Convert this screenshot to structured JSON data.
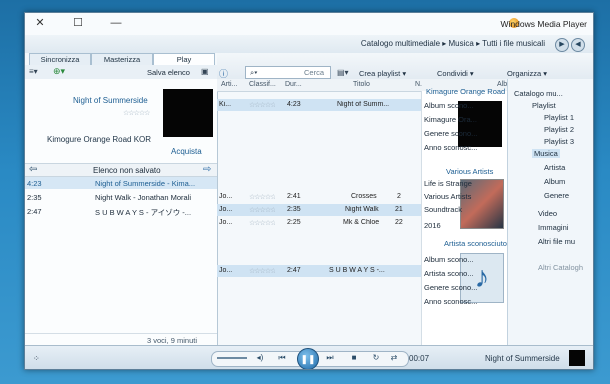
{
  "window": {
    "title": "Windows Media Player"
  },
  "nav": {
    "breadcrumb": "Catalogo multimediale ▸ Musica ▸ Tutti i file musicali",
    "back": "◀",
    "forward": "▶"
  },
  "tabs": [
    "Play",
    "Masterizza",
    "Sincronizza"
  ],
  "left_toolbar": {
    "save_label": "Salva elenco"
  },
  "toolbar": {
    "organize": "Organizza ▾",
    "share": "Condividi ▾",
    "create_playlist": "Crea playlist ▾",
    "search_placeholder": "Cerca"
  },
  "now_playing": {
    "title": "Night of Summerside",
    "artist": "Kimogure Orange Road KOR",
    "buy": "Acquista"
  },
  "playlist": {
    "header": "Elenco non salvato",
    "items": [
      {
        "title": "Night of Summerside - Kima...",
        "time": "4:23"
      },
      {
        "title": "Night Walk - Jonathan Morali",
        "time": "2:35"
      },
      {
        "title": "S U B W A Y S - アイゾウ -...",
        "time": "2:47"
      }
    ],
    "summary": "3 voci, 9 minuti"
  },
  "columns": [
    "N.",
    "Titolo",
    "Dur...",
    "Classif...",
    "Arti..."
  ],
  "album_col": "Album",
  "tracks": [
    {
      "n": "",
      "title": "Night of Summ...",
      "dur": "4:23",
      "artist": "Ki..."
    },
    {
      "n": "2",
      "title": "Crosses",
      "dur": "2:41",
      "artist": "Jo..."
    },
    {
      "n": "21",
      "title": "Night Walk",
      "dur": "2:35",
      "artist": "Jo..."
    },
    {
      "n": "22",
      "title": "Mk & Chloe",
      "dur": "2:25",
      "artist": "Jo..."
    },
    {
      "n": "",
      "title": "S U B W A Y S -...",
      "dur": "2:47",
      "artist": "Jo..."
    }
  ],
  "album_groups": [
    {
      "header": "Kimagure Orange Road KOR",
      "lines": [
        "Album scono...",
        "Kimagure Ora...",
        "Genere scono...",
        "Anno sconosc..."
      ]
    },
    {
      "header": "Various Artists",
      "lines": [
        "Life is Strange",
        "Various Artists",
        "Soundtrack",
        "2016"
      ]
    },
    {
      "header": "Artista sconosciuto",
      "lines": [
        "Album scono...",
        "Artista scono...",
        "Genere scono...",
        "Anno sconosc..."
      ]
    }
  ],
  "library": {
    "items": [
      "Catalogo mu...",
      "Playlist",
      "Playlist 1",
      "Playlist 2",
      "Playlist 3",
      "Musica",
      "Artista",
      "Album",
      "Genere",
      "Video",
      "Immagini",
      "Altri file mu",
      "Altri Catalogh"
    ]
  },
  "player": {
    "time": "00:07",
    "now_playing": "Night of Summerside"
  }
}
